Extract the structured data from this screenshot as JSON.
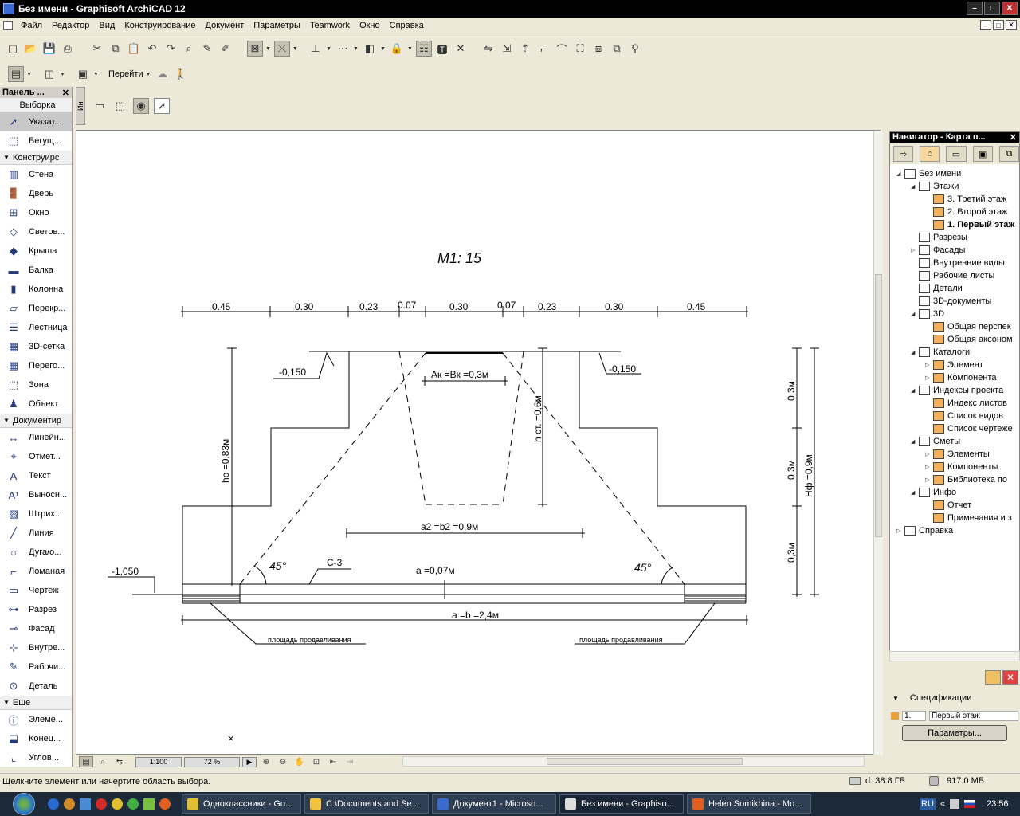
{
  "window": {
    "title": "Без имени - Graphisoft ArchiCAD 12",
    "btn_min": "–",
    "btn_max": "□",
    "btn_close": "✕"
  },
  "menu": [
    "Файл",
    "Редактор",
    "Вид",
    "Конструирование",
    "Документ",
    "Параметры",
    "Teamwork",
    "Окно",
    "Справка"
  ],
  "toolbar2": {
    "goto_label": "Перейти"
  },
  "palette": {
    "title": "Панель ...",
    "sections": {
      "select": "Выборка",
      "construct": "Конструирс",
      "document": "Документир",
      "more": "Еще"
    },
    "select_items": [
      {
        "label": "Указат...",
        "icon": "arrow-pointer-icon"
      },
      {
        "label": "Бегущ...",
        "icon": "marquee-icon"
      }
    ],
    "construct_items": [
      {
        "label": "Стена",
        "icon": "wall-icon"
      },
      {
        "label": "Дверь",
        "icon": "door-icon"
      },
      {
        "label": "Окно",
        "icon": "window-icon"
      },
      {
        "label": "Светов...",
        "icon": "skylight-icon"
      },
      {
        "label": "Крыша",
        "icon": "roof-icon"
      },
      {
        "label": "Балка",
        "icon": "beam-icon"
      },
      {
        "label": "Колонна",
        "icon": "column-icon"
      },
      {
        "label": "Перекр...",
        "icon": "slab-icon"
      },
      {
        "label": "Лестница",
        "icon": "stair-icon"
      },
      {
        "label": "3D-сетка",
        "icon": "mesh-icon"
      },
      {
        "label": "Перего...",
        "icon": "curtain-wall-icon"
      },
      {
        "label": "Зона",
        "icon": "zone-icon"
      },
      {
        "label": "Объект",
        "icon": "object-icon"
      }
    ],
    "document_items": [
      {
        "label": "Линейн...",
        "icon": "linear-dimension-icon"
      },
      {
        "label": "Отмет...",
        "icon": "level-dimension-icon"
      },
      {
        "label": "Текст",
        "icon": "text-icon"
      },
      {
        "label": "Выносн...",
        "icon": "label-icon"
      },
      {
        "label": "Штрих...",
        "icon": "fill-icon"
      },
      {
        "label": "Линия",
        "icon": "line-icon"
      },
      {
        "label": "Дуга/о...",
        "icon": "arc-icon"
      },
      {
        "label": "Ломаная",
        "icon": "polyline-icon"
      },
      {
        "label": "Чертеж",
        "icon": "drawing-icon"
      },
      {
        "label": "Разрез",
        "icon": "section-icon"
      },
      {
        "label": "Фасад",
        "icon": "elevation-icon"
      },
      {
        "label": "Внутре...",
        "icon": "interior-elevation-icon"
      },
      {
        "label": "Рабочи...",
        "icon": "worksheet-icon"
      },
      {
        "label": "Деталь",
        "icon": "detail-icon"
      }
    ],
    "more_items": [
      {
        "label": "Элеме...",
        "icon": "element-icon"
      },
      {
        "label": "Конец...",
        "icon": "endpoint-icon"
      },
      {
        "label": "Углов...",
        "icon": "corner-icon"
      }
    ]
  },
  "infobox": {
    "vertical_label": "Ин"
  },
  "drawing": {
    "scale_title": "М1: 15",
    "top_dims": [
      "0.45",
      "0.30",
      "0.23",
      "0.07",
      "0.30",
      "0.07",
      "0.23",
      "0.30",
      "0.45"
    ],
    "lvl_left": "-0,150",
    "lvl_right": "-0,150",
    "lvl_bottom": "-1,050",
    "ak": "Ак =Вк =0,3м",
    "hst": "h ст. =0,6м",
    "ho": "ho =0,83м",
    "a2": "a2 =b2 =0,9м",
    "a07": "a =0,07м",
    "ab": "a =b =2,4м",
    "c3": "С-3",
    "ang_left": "45°",
    "ang_right": "45°",
    "r1": "0,3м",
    "r2": "0,3м",
    "r3": "0,3м",
    "hf": "Нф =0,9м",
    "push_left": "площадь продавливания",
    "push_right": "площадь продавливания",
    "marker": "×"
  },
  "hbar": {
    "scale": "1:100",
    "zoom": "72 %"
  },
  "navigator": {
    "title": "Навигатор - Карта п...",
    "tree": [
      {
        "label": "Без имени",
        "indent": 0,
        "exp": "◢"
      },
      {
        "label": "Этажи",
        "indent": 1,
        "exp": "◢"
      },
      {
        "label": "3. Третий этаж",
        "indent": 2,
        "exp": ""
      },
      {
        "label": "2. Второй этаж",
        "indent": 2,
        "exp": ""
      },
      {
        "label": "1. Первый этаж",
        "indent": 2,
        "exp": "",
        "bold": true
      },
      {
        "label": "Разрезы",
        "indent": 1,
        "exp": ""
      },
      {
        "label": "Фасады",
        "indent": 1,
        "exp": "▷"
      },
      {
        "label": "Внутренние виды",
        "indent": 1,
        "exp": ""
      },
      {
        "label": "Рабочие листы",
        "indent": 1,
        "exp": ""
      },
      {
        "label": "Детали",
        "indent": 1,
        "exp": ""
      },
      {
        "label": "3D-документы",
        "indent": 1,
        "exp": ""
      },
      {
        "label": "3D",
        "indent": 1,
        "exp": "◢"
      },
      {
        "label": "Общая перспек",
        "indent": 2,
        "exp": ""
      },
      {
        "label": "Общая аксоном",
        "indent": 2,
        "exp": ""
      },
      {
        "label": "Каталоги",
        "indent": 1,
        "exp": "◢"
      },
      {
        "label": "Элемент",
        "indent": 2,
        "exp": "▷"
      },
      {
        "label": "Компонента",
        "indent": 2,
        "exp": "▷"
      },
      {
        "label": "Индексы проекта",
        "indent": 1,
        "exp": "◢"
      },
      {
        "label": "Индекс листов",
        "indent": 2,
        "exp": ""
      },
      {
        "label": "Список видов",
        "indent": 2,
        "exp": ""
      },
      {
        "label": "Список чертеже",
        "indent": 2,
        "exp": ""
      },
      {
        "label": "Сметы",
        "indent": 1,
        "exp": "◢"
      },
      {
        "label": "Элементы",
        "indent": 2,
        "exp": "▷"
      },
      {
        "label": "Компоненты",
        "indent": 2,
        "exp": "▷"
      },
      {
        "label": "Библиотека по",
        "indent": 2,
        "exp": "▷"
      },
      {
        "label": "Инфо",
        "indent": 1,
        "exp": "◢"
      },
      {
        "label": "Отчет",
        "indent": 2,
        "exp": ""
      },
      {
        "label": "Примечания и з",
        "indent": 2,
        "exp": ""
      },
      {
        "label": "Справка",
        "indent": 0,
        "exp": "▷"
      }
    ],
    "spec_label": "Спецификации",
    "spec_num": "1.",
    "spec_value": "Первый этаж",
    "params_button": "Параметры..."
  },
  "status": {
    "message": "Щелкните элемент или начертите область выбора.",
    "disk": "d: 38.8 ГБ",
    "mem": "917.0 МБ"
  },
  "taskbar": {
    "buttons": [
      "Одноклассники - Go...",
      "C:\\Documents and Se...",
      "Документ1 - Microso...",
      "Без имени - Graphiso...",
      "Helen Somikhina - Mo..."
    ],
    "lang": "RU",
    "time": "23:56"
  }
}
